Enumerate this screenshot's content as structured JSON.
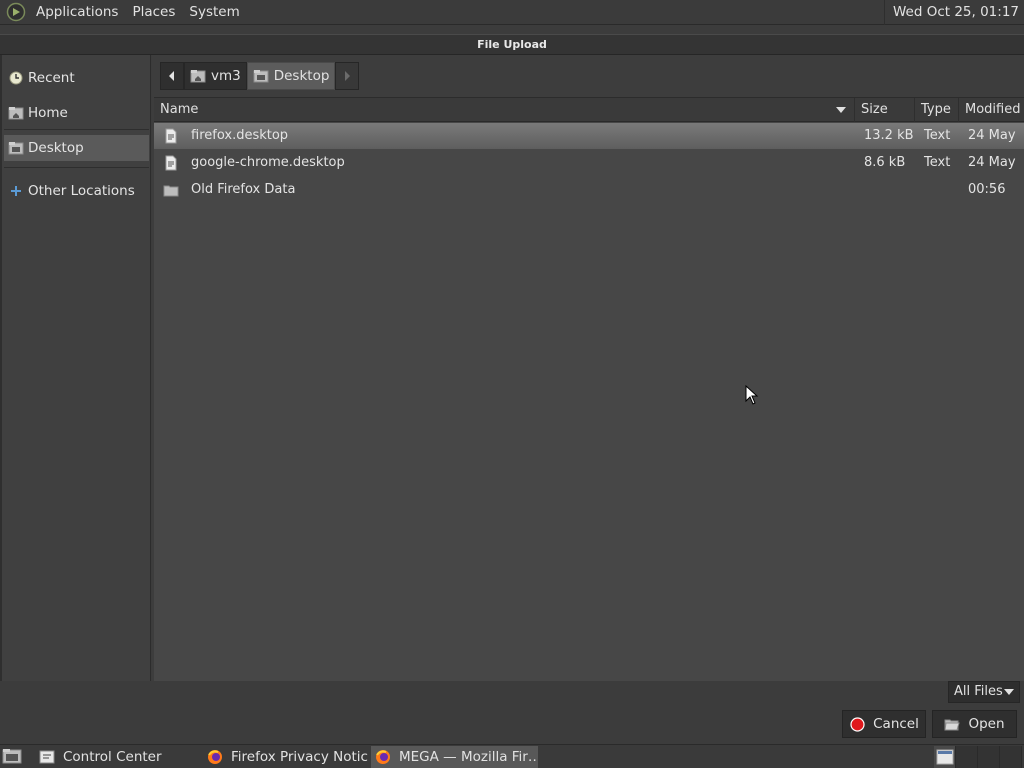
{
  "top_panel": {
    "menus": [
      "Applications",
      "Places",
      "System"
    ],
    "clock": "Wed Oct 25, 01:17"
  },
  "dialog": {
    "title": "File Upload"
  },
  "sidebar": {
    "items": [
      {
        "label": "Recent",
        "icon": "clock-icon"
      },
      {
        "label": "Home",
        "icon": "home-folder-icon"
      },
      {
        "label": "Desktop",
        "icon": "desktop-folder-icon",
        "selected": true
      },
      {
        "label": "Other Locations",
        "icon": "plus-icon"
      }
    ]
  },
  "pathbar": {
    "crumbs": [
      "vm3",
      "Desktop"
    ],
    "active": "Desktop"
  },
  "columns": {
    "name": "Name",
    "size": "Size",
    "type": "Type",
    "modified": "Modified"
  },
  "files": [
    {
      "name": "firefox.desktop",
      "size": "13.2 kB",
      "type": "Text",
      "modified": "24 May",
      "icon": "text-file-icon",
      "selected": true
    },
    {
      "name": "google-chrome.desktop",
      "size": "8.6 kB",
      "type": "Text",
      "modified": "24 May",
      "icon": "text-file-icon"
    },
    {
      "name": "Old Firefox Data",
      "size": "",
      "type": "",
      "modified": "00:56",
      "icon": "folder-icon"
    }
  ],
  "filter": {
    "selected": "All Files"
  },
  "buttons": {
    "cancel": "Cancel",
    "open": "Open"
  },
  "taskbar": {
    "tasks": [
      {
        "label": "Control Center",
        "icon": "control-center-icon"
      },
      {
        "label": "Firefox Privacy Notic…",
        "icon": "firefox-icon"
      },
      {
        "label": "MEGA — Mozilla Fir…",
        "icon": "firefox-icon",
        "active": true
      }
    ]
  },
  "colors": {
    "background": "#3c3c3c",
    "selection": "#6e6e6e",
    "accent_blue": "#5b9bd5",
    "cancel_red": "#e0181c"
  }
}
